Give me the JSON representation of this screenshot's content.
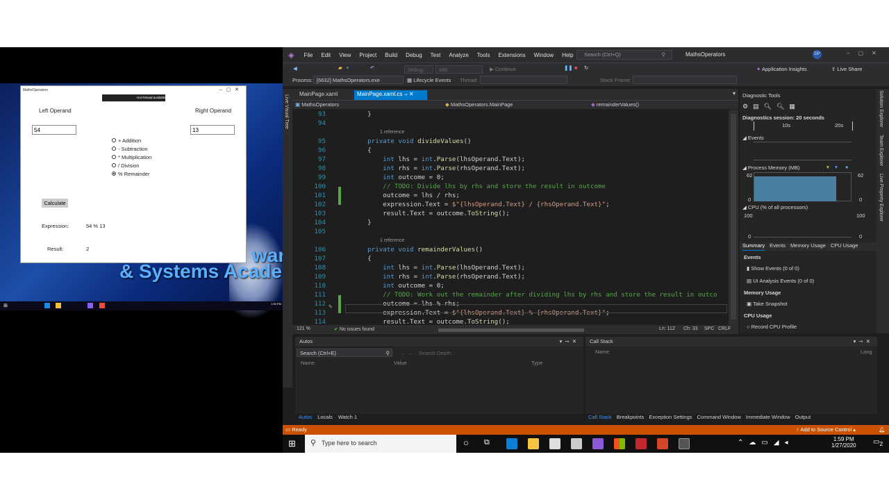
{
  "left_app": {
    "window_title": "MathsOperators",
    "left_label": "Left Operand",
    "right_label": "Right Operand",
    "left_value": "54",
    "right_value": "13",
    "radios": [
      "+ Addition",
      "- Subtraction",
      "* Multiplication",
      "/ Division",
      "% Remainder"
    ],
    "selected_radio": "% Remainder",
    "calc_label": "Calculate",
    "expr_label": "Expression:",
    "expr_value": "54 % 13",
    "result_label": "Result:",
    "result_value": "2",
    "hot_reload": "Hot Reload available",
    "brand_line1": "war",
    "brand_line2": "& Systems Acade"
  },
  "vs": {
    "menu": [
      "File",
      "Edit",
      "View",
      "Project",
      "Build",
      "Debug",
      "Test",
      "Analyze",
      "Tools",
      "Extensions",
      "Window",
      "Help"
    ],
    "search_placeholder": "Search (Ctrl+Q)",
    "solution_name": "MathsOperators",
    "user_initials": "DP",
    "toolbar": {
      "config": "Debug",
      "platform": "x86",
      "continue": "Continue",
      "insights": "Application Insights",
      "live_share": "Live Share"
    },
    "process_label": "Process:",
    "process_value": "[6632] MathsOperators.exe",
    "lifecycle": "Lifecycle Events",
    "thread_label": "Thread:",
    "stack_frame_label": "Stack Frame:",
    "tabs": [
      "MainPage.xaml",
      "MainPage.xaml.cs"
    ],
    "active_tab": "MainPage.xaml.cs",
    "nav": {
      "project": "MathsOperators",
      "class": "MathsOperators.MainPage",
      "member": "remainderValues()"
    },
    "vertical_left": "Live Visual Tree",
    "vertical_right": [
      "Solution Explorer",
      "Team Explorer",
      "Live Property Explorer"
    ],
    "code_lines": [
      {
        "n": "93",
        "html": "    }"
      },
      {
        "n": "94",
        "html": ""
      },
      {
        "ref": "1 reference"
      },
      {
        "n": "95",
        "html": "    <span class='kw'>private</span> <span class='kw'>void</span> <span class='mt'>divideValues</span>()"
      },
      {
        "n": "96",
        "html": "    {"
      },
      {
        "n": "97",
        "html": "        <span class='kw'>int</span> lhs = <span class='kw'>int</span>.<span class='mt'>Parse</span>(lhsOperand.Text);"
      },
      {
        "n": "98",
        "html": "        <span class='kw'>int</span> rhs = <span class='kw'>int</span>.<span class='mt'>Parse</span>(rhsOperand.Text);"
      },
      {
        "n": "99",
        "html": "        <span class='kw'>int</span> outcome = 0;"
      },
      {
        "n": "100",
        "html": "        <span class='cm'>// TODO: Divide lhs by rhs and store the result in outcome</span>"
      },
      {
        "n": "101",
        "html": "        outcome = lhs / rhs;"
      },
      {
        "n": "102",
        "html": "        expression.Text = <span class='st'>$\"{lhsOperand.Text} / {rhsOperand.Text}\"</span>;"
      },
      {
        "n": "103",
        "html": "        result.Text = outcome.<span class='mt'>ToString</span>();"
      },
      {
        "n": "104",
        "html": "    }"
      },
      {
        "n": "105",
        "html": ""
      },
      {
        "ref": "1 reference"
      },
      {
        "n": "106",
        "html": "    <span class='kw'>private</span> <span class='kw'>void</span> <span class='mt'>remainderValues</span>()"
      },
      {
        "n": "107",
        "html": "    {"
      },
      {
        "n": "108",
        "html": "        <span class='kw'>int</span> lhs = <span class='kw'>int</span>.<span class='mt'>Parse</span>(lhsOperand.Text);"
      },
      {
        "n": "109",
        "html": "        <span class='kw'>int</span> rhs = <span class='kw'>int</span>.<span class='mt'>Parse</span>(rhsOperand.Text);"
      },
      {
        "n": "110",
        "html": "        <span class='kw'>int</span> outcome = 0;"
      },
      {
        "n": "111",
        "html": "        <span class='cm'>// TODO: Work out the remainder after dividing lhs by rhs and store the result in outco</span>"
      },
      {
        "n": "112",
        "html": "        outcome = lhs % rhs;"
      },
      {
        "n": "113",
        "html": "        expression.Text = <span class='st'>$\"{lhsOperand.Text} % {rhsOperand.Text}\"</span>;"
      },
      {
        "n": "114",
        "html": "        result.Text = outcome.<span class='mt'>ToString</span>();"
      }
    ],
    "editor_status": {
      "zoom": "121 %",
      "issues": "No issues found",
      "ln": "Ln: 112",
      "ch": "Ch: 33",
      "spc": "SPC",
      "crlf": "CRLF"
    },
    "diag": {
      "title": "Diagnostic Tools",
      "session": "Diagnostics session: 20 seconds",
      "t1": "10s",
      "t2": "20s",
      "events": "Events",
      "mem_title": "Process Memory (MB)",
      "mem_max": "62",
      "mem_min": "0",
      "cpu_title": "CPU (% of all processors)",
      "cpu_max": "100",
      "cpu_min": "0",
      "tabs": [
        "Summary",
        "Events",
        "Memory Usage",
        "CPU Usage"
      ],
      "events_head": "Events",
      "show_events": "Show Events (0 of 0)",
      "ui_events": "UI Analysis Events (0 of 0)",
      "mem_head": "Memory Usage",
      "snapshot": "Take Snapshot",
      "cpu_head": "CPU Usage",
      "record": "Record CPU Profile"
    },
    "autos": {
      "title": "Autos",
      "search": "Search (Ctrl+E)",
      "depth": "Search Depth:",
      "cols": [
        "Name",
        "Value",
        "Type"
      ],
      "tabs": [
        "Autos",
        "Locals",
        "Watch 1"
      ]
    },
    "callstack": {
      "title": "Call Stack",
      "cols": [
        "Name",
        "Lang"
      ],
      "tabs": [
        "Call Stack",
        "Breakpoints",
        "Exception Settings",
        "Command Window",
        "Immediate Window",
        "Output"
      ]
    },
    "status": {
      "ready": "Ready",
      "source": "Add to Source Control"
    }
  },
  "taskbar": {
    "search": "Type here to search",
    "time": "1:59 PM",
    "date": "1/27/2020",
    "notif": "2"
  },
  "colors": {
    "vs_accent": "#007acc",
    "status": "#ca5100",
    "mem_fill": "#4a7fa0"
  }
}
